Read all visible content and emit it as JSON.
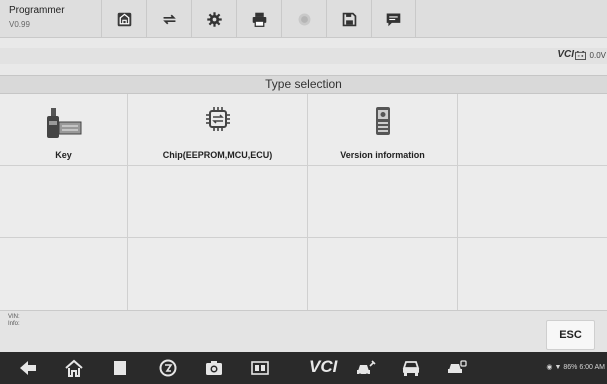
{
  "header": {
    "title": "Programmer",
    "version": "V0.99"
  },
  "toolbar": {
    "buttons": [
      {
        "name": "home-button",
        "icon": "home-icon"
      },
      {
        "name": "vehicle-swap-button",
        "icon": "vehicle-swap-icon"
      },
      {
        "name": "settings-button",
        "icon": "gear-icon"
      },
      {
        "name": "print-button",
        "icon": "printer-icon"
      },
      {
        "name": "help-button",
        "icon": "help-icon"
      },
      {
        "name": "save-button",
        "icon": "save-icon"
      },
      {
        "name": "message-button",
        "icon": "message-icon"
      }
    ]
  },
  "status": {
    "vci": "VCI",
    "voltage": "0.0V"
  },
  "section": {
    "title": "Type selection"
  },
  "grid": {
    "items": [
      {
        "label": "Key",
        "icon": "key-programmer-icon"
      },
      {
        "label": "Chip(EEPROM,MCU,ECU)",
        "icon": "chip-icon"
      },
      {
        "label": "Version information",
        "icon": "device-info-icon"
      }
    ]
  },
  "info": {
    "vin_label": "VIN:",
    "info_label": "Info:"
  },
  "actions": {
    "esc": "ESC"
  },
  "sysnav": {
    "vci": "VCI",
    "status_text": "86% 6:00 AM"
  },
  "colors": {
    "background": "#e9e9e9",
    "header": "#dedede",
    "nav_bar": "#2a2a2a",
    "icon_dark": "#333333"
  }
}
